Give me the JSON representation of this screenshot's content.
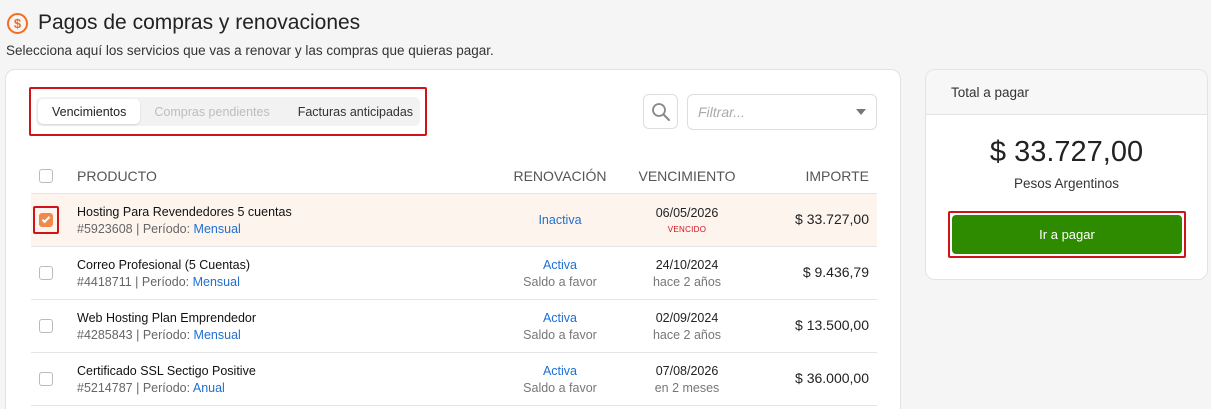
{
  "header": {
    "title": "Pagos de compras y renovaciones",
    "subtitle": "Selecciona aquí los servicios que vas a renovar y las compras que quieras pagar."
  },
  "tabs": [
    {
      "label": "Vencimientos",
      "active": true
    },
    {
      "label": "Compras pendientes",
      "disabled": true
    },
    {
      "label": "Facturas anticipadas"
    }
  ],
  "filter": {
    "placeholder": "Filtrar..."
  },
  "table": {
    "headers": {
      "product": "PRODUCTO",
      "renewal": "RENOVACIÓN",
      "due": "VENCIMIENTO",
      "amount": "IMPORTE"
    },
    "rows": [
      {
        "name": "Hosting Para Revendedores 5 cuentas",
        "id": "#5923608",
        "period_label": " | Período: ",
        "period": "Mensual",
        "status": "Inactiva",
        "status_sub": "",
        "date": "06/05/2026",
        "date_sub": "VENCIDO",
        "amount": "$ 33.727,00",
        "checked": true
      },
      {
        "name": "Correo Profesional (5 Cuentas)",
        "id": "#4418711",
        "period_label": " | Período: ",
        "period": "Mensual",
        "status": "Activa",
        "status_sub": "Saldo a favor",
        "date": "24/10/2024",
        "date_sub": "hace 2 años",
        "amount": "$ 9.436,79",
        "checked": false
      },
      {
        "name": "Web Hosting Plan Emprendedor",
        "id": "#4285843",
        "period_label": " | Período: ",
        "period": "Mensual",
        "status": "Activa",
        "status_sub": "Saldo a favor",
        "date": "02/09/2024",
        "date_sub": "hace 2 años",
        "amount": "$ 13.500,00",
        "checked": false
      },
      {
        "name": "Certificado SSL Sectigo Positive",
        "id": "#5214787",
        "period_label": " | Período: ",
        "period": "Anual",
        "status": "Activa",
        "status_sub": "Saldo a favor",
        "date": "07/08/2026",
        "date_sub": "en 2 meses",
        "amount": "$ 36.000,00",
        "checked": false
      }
    ]
  },
  "summary": {
    "heading": "Total a pagar",
    "total": "$ 33.727,00",
    "currency": "Pesos Argentinos",
    "pay_label": "Ir a pagar"
  },
  "colors": {
    "accent": "#f26d21",
    "link": "#1f6fd1",
    "pay": "#2e8b00",
    "highlight": "#d0121b"
  }
}
